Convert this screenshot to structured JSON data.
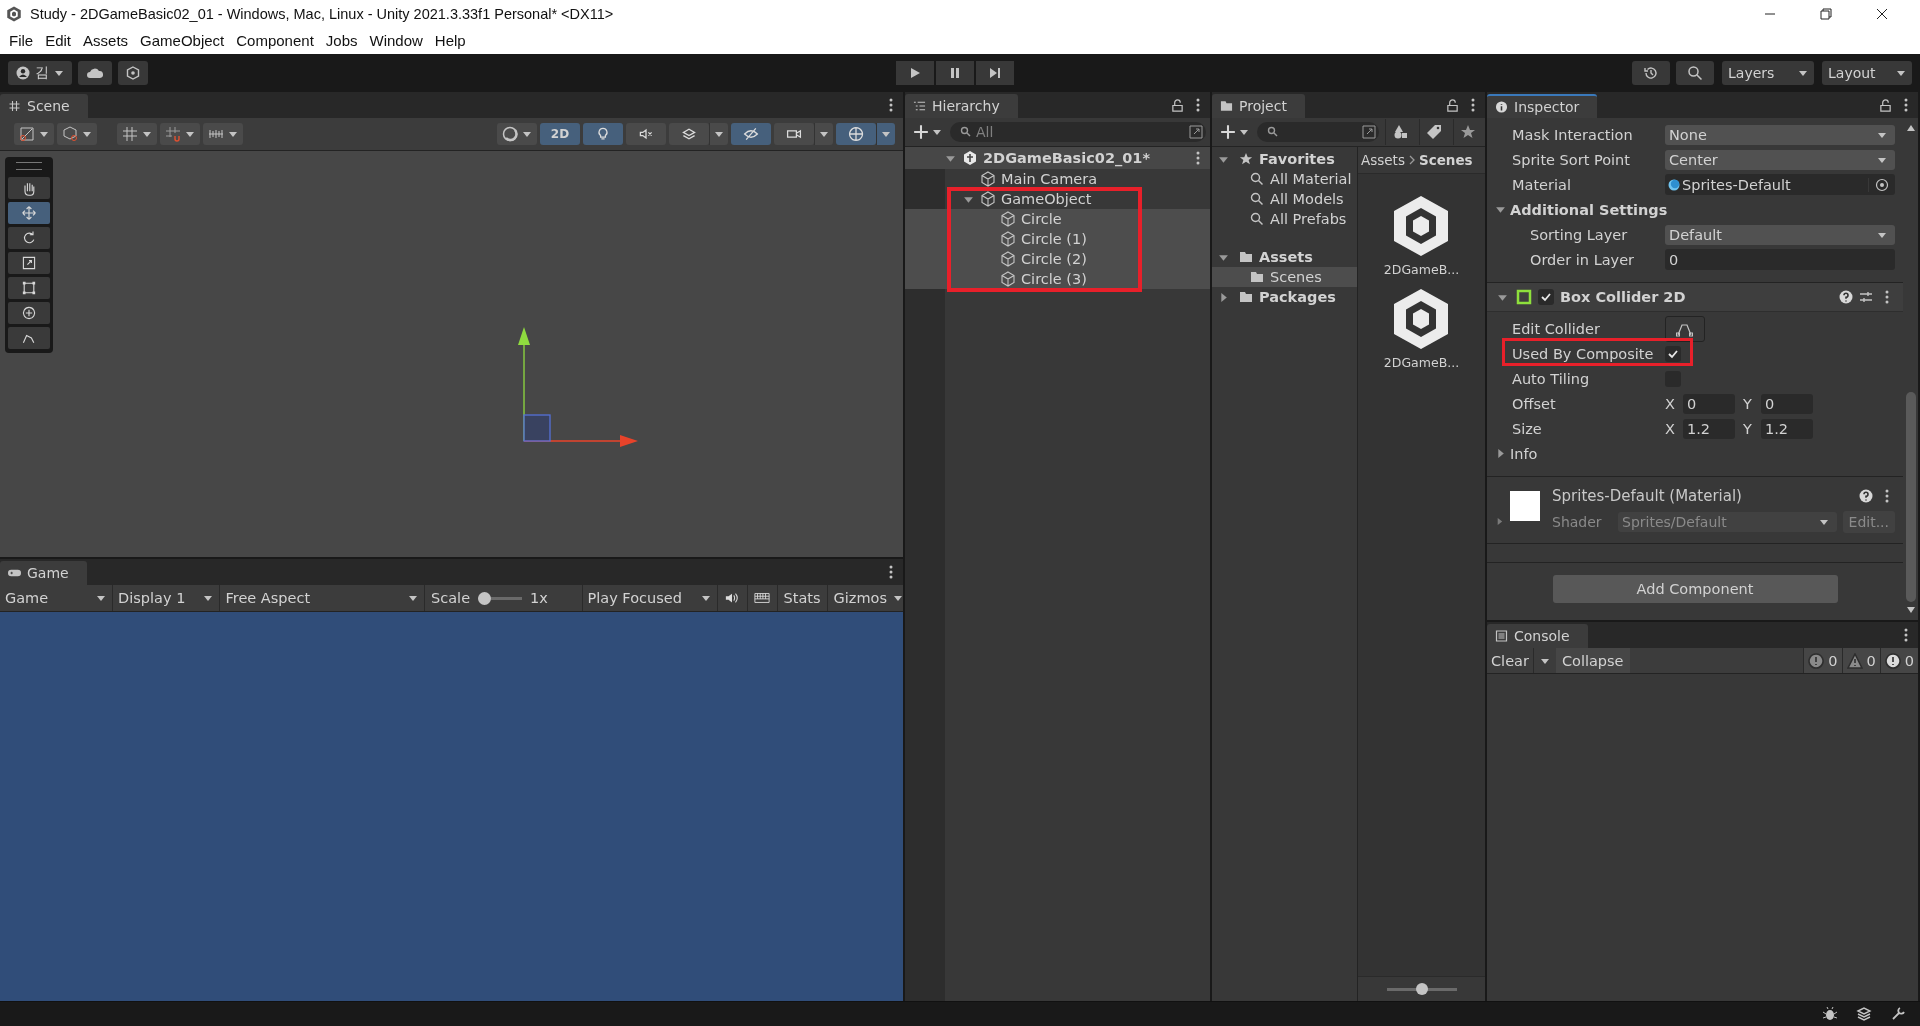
{
  "window": {
    "title": "Study - 2DGameBasic02_01 - Windows, Mac, Linux - Unity 2021.3.33f1 Personal* <DX11>"
  },
  "menu": [
    "File",
    "Edit",
    "Assets",
    "GameObject",
    "Component",
    "Jobs",
    "Window",
    "Help"
  ],
  "toolbar": {
    "account": "김",
    "layers": "Layers",
    "layout": "Layout"
  },
  "scene": {
    "tab": "Scene",
    "tools": [
      {
        "kind": "hand",
        "selected": false
      },
      {
        "kind": "move",
        "selected": true
      },
      {
        "kind": "rotate",
        "selected": false
      },
      {
        "kind": "scale",
        "selected": false
      },
      {
        "kind": "rect",
        "selected": false
      },
      {
        "kind": "transform",
        "selected": false
      },
      {
        "kind": "custom",
        "selected": false
      }
    ],
    "toggles": [
      {
        "kind": "mode",
        "label": "2D",
        "on": true
      },
      {
        "kind": "lighting",
        "on": true
      },
      {
        "kind": "audio",
        "on": false
      },
      {
        "kind": "effects",
        "on": false
      },
      {
        "kind": "visibility",
        "on": true
      },
      {
        "kind": "camera",
        "on": false
      },
      {
        "kind": "gizmos",
        "on": true
      }
    ]
  },
  "game": {
    "tab": "Game",
    "mode": "Game",
    "display": "Display 1",
    "aspect": "Free Aspect",
    "scale_label": "Scale",
    "scale": {
      "level": 0
    },
    "scale_value": "1x",
    "play_mode": "Play Focused",
    "stats": "Stats",
    "gizmos": "Gizmos"
  },
  "hierarchy": {
    "tab": "Hierarchy",
    "search": {
      "placeholder": "All"
    },
    "scene": {
      "name": "2DGameBasic02_01*",
      "expanded": true,
      "children": [
        {
          "name": "Main Camera",
          "selected": false
        },
        {
          "name": "GameObject",
          "selected": false,
          "expanded": true,
          "highlighted": true,
          "children": [
            {
              "name": "Circle",
              "selected": true
            },
            {
              "name": "Circle (1)",
              "selected": true
            },
            {
              "name": "Circle (2)",
              "selected": true
            },
            {
              "name": "Circle (3)",
              "selected": true
            }
          ]
        }
      ]
    }
  },
  "project": {
    "tab": "Project",
    "favorites": {
      "label": "Favorites",
      "expanded": true,
      "items": [
        "All Material",
        "All Models",
        "All Prefabs"
      ]
    },
    "folders": [
      {
        "label": "Assets",
        "expanded": true,
        "children": [
          {
            "label": "Scenes",
            "selected": true
          }
        ]
      },
      {
        "label": "Packages",
        "expanded": false
      }
    ],
    "breadcrumb": [
      "Assets",
      "Scenes"
    ],
    "files": [
      {
        "name": "2DGameB..."
      },
      {
        "name": "2DGameB..."
      }
    ],
    "zoom": {
      "level": 0.5
    }
  },
  "inspector": {
    "tab": "Inspector",
    "properties": [
      {
        "kind": "dropdown",
        "label": "Mask Interaction",
        "value": "None"
      },
      {
        "kind": "dropdown",
        "label": "Sprite Sort Point",
        "value": "Center"
      },
      {
        "kind": "object",
        "label": "Material",
        "value": "Sprites-Default"
      },
      {
        "kind": "section",
        "label": "Additional Settings",
        "expanded": true,
        "children": [
          {
            "kind": "dropdown",
            "label": "Sorting Layer",
            "value": "Default"
          },
          {
            "kind": "number",
            "label": "Order in Layer",
            "value": "0"
          }
        ]
      }
    ],
    "component": {
      "name": "Box Collider 2D",
      "enabled": true,
      "expanded": true,
      "properties": [
        {
          "kind": "button",
          "label": "Edit Collider"
        },
        {
          "kind": "checkbox",
          "label": "Used By Composite",
          "checked": true,
          "highlighted": true
        },
        {
          "kind": "checkbox",
          "label": "Auto Tiling",
          "checked": false,
          "highlighted": false
        },
        {
          "kind": "vector2",
          "label": "Offset",
          "fields": [
            {
              "axis": "X",
              "value": "0"
            },
            {
              "axis": "Y",
              "value": "0"
            }
          ]
        },
        {
          "kind": "vector2",
          "label": "Size",
          "fields": [
            {
              "axis": "X",
              "value": "1.2"
            },
            {
              "axis": "Y",
              "value": "1.2"
            }
          ]
        },
        {
          "kind": "foldout",
          "label": "Info",
          "expanded": false
        }
      ]
    },
    "material": {
      "name": "Sprites-Default (Material)",
      "shader_label": "Shader",
      "shader": "Sprites/Default",
      "edit": "Edit...",
      "expanded": false
    },
    "add_component": "Add Component"
  },
  "console": {
    "tab": "Console",
    "clear": "Clear",
    "collapse": "Collapse",
    "counts": [
      {
        "kind": "info",
        "value": "0"
      },
      {
        "kind": "warning",
        "value": "0"
      },
      {
        "kind": "error",
        "value": "0"
      }
    ]
  }
}
